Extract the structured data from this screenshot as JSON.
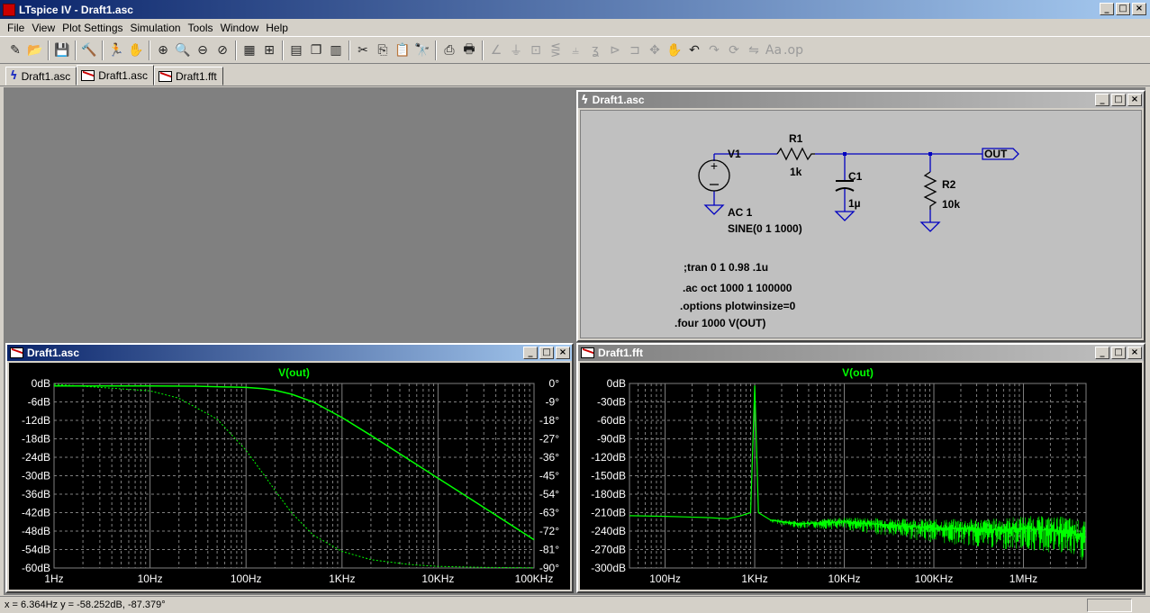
{
  "app": {
    "title": "LTspice IV - Draft1.asc"
  },
  "window_buttons": {
    "minimize": "_",
    "maximize": "□",
    "close": "×"
  },
  "menu": [
    "File",
    "View",
    "Plot Settings",
    "Simulation",
    "Tools",
    "Window",
    "Help"
  ],
  "toolbar": [
    {
      "icon": "edit-icon",
      "glyph": "✎"
    },
    {
      "icon": "open-icon",
      "glyph": "📂"
    },
    {
      "sep": true
    },
    {
      "icon": "save-icon",
      "glyph": "💾"
    },
    {
      "sep": true
    },
    {
      "icon": "control-panel-icon",
      "glyph": "🔨"
    },
    {
      "sep": true
    },
    {
      "icon": "run-icon",
      "glyph": "🏃"
    },
    {
      "icon": "halt-icon",
      "glyph": "✋",
      "dim": true
    },
    {
      "sep": true
    },
    {
      "icon": "zoom-in-icon",
      "glyph": "⊕"
    },
    {
      "icon": "zoom-pan-icon",
      "glyph": "🔍"
    },
    {
      "icon": "zoom-out-icon",
      "glyph": "⊖"
    },
    {
      "icon": "zoom-cancel-icon",
      "glyph": "⊘"
    },
    {
      "sep": true
    },
    {
      "icon": "autorange-icon",
      "glyph": "▦"
    },
    {
      "icon": "zoom-fit-icon",
      "glyph": "⊞"
    },
    {
      "sep": true
    },
    {
      "icon": "tile-horizontal-icon",
      "glyph": "▤"
    },
    {
      "icon": "cascade-icon",
      "glyph": "❐"
    },
    {
      "icon": "tile-vertical-icon",
      "glyph": "▥"
    },
    {
      "sep": true
    },
    {
      "icon": "cut-icon",
      "glyph": "✂"
    },
    {
      "icon": "copy-icon",
      "glyph": "⎘"
    },
    {
      "icon": "paste-icon",
      "glyph": "📋"
    },
    {
      "icon": "find-icon",
      "glyph": "🔭"
    },
    {
      "sep": true
    },
    {
      "icon": "print-setup-icon",
      "glyph": "⎙"
    },
    {
      "icon": "print-icon",
      "glyph": "🖶"
    },
    {
      "sep": true
    },
    {
      "icon": "wire-icon",
      "glyph": "∠",
      "dim": true
    },
    {
      "icon": "ground-icon",
      "glyph": "⏚",
      "dim": true
    },
    {
      "icon": "label-net-icon",
      "glyph": "⊡",
      "dim": true
    },
    {
      "icon": "resistor-icon",
      "glyph": "⋚",
      "dim": true
    },
    {
      "icon": "capacitor-icon",
      "glyph": "⫨",
      "dim": true
    },
    {
      "icon": "inductor-icon",
      "glyph": "ʓ",
      "dim": true
    },
    {
      "icon": "diode-icon",
      "glyph": "⊳",
      "dim": true
    },
    {
      "icon": "component-icon",
      "glyph": "⊐",
      "dim": true
    },
    {
      "icon": "move-icon",
      "glyph": "✥",
      "dim": true
    },
    {
      "icon": "drag-icon",
      "glyph": "✋",
      "dim": true
    },
    {
      "icon": "undo-icon",
      "glyph": "↶"
    },
    {
      "icon": "redo-icon",
      "glyph": "↷",
      "dim": true
    },
    {
      "icon": "rotate-icon",
      "glyph": "⟳",
      "dim": true
    },
    {
      "icon": "mirror-icon",
      "glyph": "⇋",
      "dim": true
    },
    {
      "icon": "text-icon",
      "glyph": "Aa",
      "dim": true
    },
    {
      "icon": "spice-directive-icon",
      "glyph": ".op",
      "dim": true
    }
  ],
  "tabs": [
    {
      "label": "Draft1.asc",
      "icon": "schematic-icon",
      "active": false
    },
    {
      "label": "Draft1.asc",
      "icon": "waveform-icon",
      "active": true
    },
    {
      "label": "Draft1.fft",
      "icon": "waveform-icon",
      "active": false
    }
  ],
  "schematic": {
    "title": "Draft1.asc",
    "labels": {
      "v1": "V1",
      "v1_ac": "AC 1",
      "v1_sine": "SINE(0 1 1000)",
      "r1": "R1",
      "r1_val": "1k",
      "c1": "C1",
      "c1_val": "1µ",
      "r2": "R2",
      "r2_val": "10k",
      "out": "OUT"
    },
    "directives": [
      ";tran 0 1 0.98 .1u",
      ".ac oct 1000 1 100000",
      ".options plotwinsize=0",
      ".four 1000 V(OUT)"
    ],
    "wire_color": "#0000c0"
  },
  "plot_ac": {
    "title": "Draft1.asc",
    "trace_label": "V(out)",
    "trace_color": "#00ff00",
    "grid_color": "#808080"
  },
  "plot_fft": {
    "title": "Draft1.fft",
    "trace_label": "V(out)",
    "trace_color": "#00ff00"
  },
  "chart_data": [
    {
      "type": "line",
      "title": "V(out)",
      "x_scale": "log",
      "xlim": [
        1,
        100000
      ],
      "x_ticks": [
        "1Hz",
        "10Hz",
        "100Hz",
        "1KHz",
        "10KHz",
        "100KHz"
      ],
      "y_left_ticks": [
        "0dB",
        "-6dB",
        "-12dB",
        "-18dB",
        "-24dB",
        "-30dB",
        "-36dB",
        "-42dB",
        "-48dB",
        "-54dB",
        "-60dB"
      ],
      "y_right_ticks": [
        "0°",
        "-9°",
        "-18°",
        "-27°",
        "-36°",
        "-45°",
        "-54°",
        "-63°",
        "-72°",
        "-81°",
        "-90°"
      ],
      "ylim_left": [
        -60,
        0
      ],
      "ylim_right": [
        -90,
        0
      ],
      "grid": true,
      "series": [
        {
          "name": "V(out)",
          "style": "solid",
          "axis": "left",
          "x": [
            1,
            10,
            30,
            100,
            150,
            200,
            300,
            500,
            1000,
            2000,
            5000,
            10000,
            30000,
            100000
          ],
          "values": [
            -0.83,
            -0.83,
            -0.88,
            -1.3,
            -1.7,
            -2.2,
            -3.5,
            -6.0,
            -11.1,
            -16.9,
            -24.8,
            -30.8,
            -40.3,
            -50.8
          ]
        },
        {
          "name": "V(out)",
          "style": "dashed",
          "axis": "right",
          "x": [
            1,
            10,
            20,
            50,
            100,
            150,
            200,
            300,
            500,
            1000,
            2000,
            5000,
            10000,
            30000,
            100000
          ],
          "values": [
            -0.4,
            -3.6,
            -7.2,
            -17.4,
            -32.6,
            -43.9,
            -52.1,
            -63.2,
            -73.9,
            -81.9,
            -85.9,
            -88.3,
            -89.2,
            -89.7,
            -89.9
          ]
        }
      ]
    },
    {
      "type": "line",
      "title": "V(out)",
      "x_scale": "log",
      "xlim": [
        40,
        5000000
      ],
      "x_ticks": [
        "100Hz",
        "1KHz",
        "10KHz",
        "100KHz",
        "1MHz"
      ],
      "y_ticks": [
        "0dB",
        "-30dB",
        "-60dB",
        "-90dB",
        "-120dB",
        "-150dB",
        "-180dB",
        "-210dB",
        "-240dB",
        "-270dB",
        "-300dB"
      ],
      "ylim": [
        -300,
        0
      ],
      "grid": true,
      "series": [
        {
          "name": "V(out)",
          "x": [
            40,
            100,
            300,
            500,
            700,
            900,
            1000,
            1100,
            1500,
            3000,
            10000,
            50000,
            100000,
            500000,
            1000000,
            3000000,
            5000000
          ],
          "values": [
            -215,
            -216,
            -218,
            -220,
            -215,
            -210,
            -3,
            -210,
            -222,
            -228,
            -225,
            -232,
            -235,
            -238,
            -236,
            -240,
            -250
          ]
        }
      ]
    }
  ],
  "status": {
    "text": "x = 6.364Hz    y = -58.252dB, -87.379°"
  }
}
